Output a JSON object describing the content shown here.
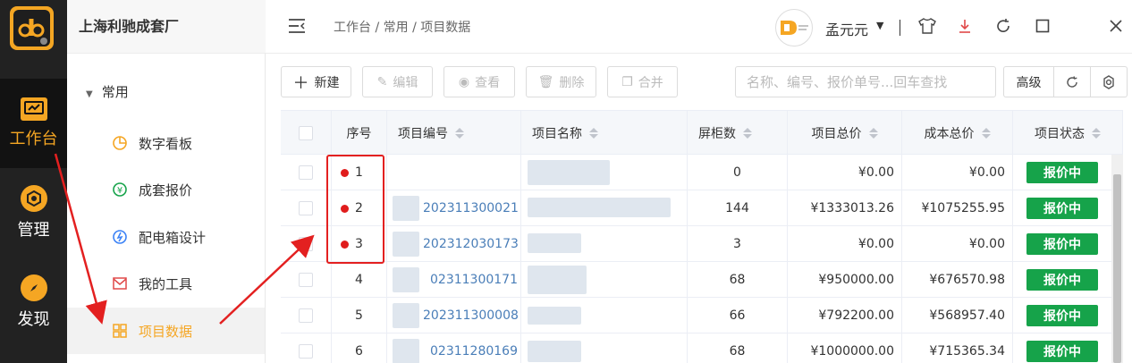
{
  "app": {
    "company": "上海利驰成套厂"
  },
  "rail": {
    "items": [
      {
        "label": "工作台"
      },
      {
        "label": "管理"
      },
      {
        "label": "发现"
      }
    ]
  },
  "submenu": {
    "group": "常用",
    "items": [
      {
        "label": "数字看板"
      },
      {
        "label": "成套报价"
      },
      {
        "label": "配电箱设计"
      },
      {
        "label": "我的工具"
      },
      {
        "label": "项目数据"
      }
    ]
  },
  "header": {
    "breadcrumb": "工作台 / 常用 / 项目数据",
    "user_name": "孟元元"
  },
  "toolbar": {
    "new": "新建",
    "edit": "编辑",
    "view": "查看",
    "delete": "删除",
    "merge": "合并",
    "search_placeholder": "名称、编号、报价单号...回车查找",
    "advanced": "高级"
  },
  "table": {
    "columns": [
      "序号",
      "项目编号",
      "项目名称",
      "屏柜数",
      "项目总价",
      "成本总价",
      "项目状态"
    ],
    "rows": [
      {
        "index": "1",
        "code": "",
        "cabinets": "0",
        "total": "¥0.00",
        "cost": "¥0.00",
        "status": "报价中"
      },
      {
        "index": "2",
        "code": "202311300021",
        "cabinets": "144",
        "total": "¥1333013.26",
        "cost": "¥1075255.95",
        "status": "报价中"
      },
      {
        "index": "3",
        "code": "202312030173",
        "cabinets": "3",
        "total": "¥0.00",
        "cost": "¥0.00",
        "status": "报价中"
      },
      {
        "index": "4",
        "code": "02311300171",
        "cabinets": "68",
        "total": "¥950000.00",
        "cost": "¥676570.98",
        "status": "报价中"
      },
      {
        "index": "5",
        "code": "202311300008",
        "cabinets": "66",
        "total": "¥792200.00",
        "cost": "¥568957.40",
        "status": "报价中"
      },
      {
        "index": "6",
        "code": "02311280169",
        "cabinets": "68",
        "total": "¥1000000.00",
        "cost": "¥715365.34",
        "status": "报价中"
      }
    ]
  },
  "colors": {
    "accent": "#f5a623",
    "status_green": "#16a34a",
    "annotation_red": "#e32020",
    "link_blue": "#4a7eb8"
  }
}
